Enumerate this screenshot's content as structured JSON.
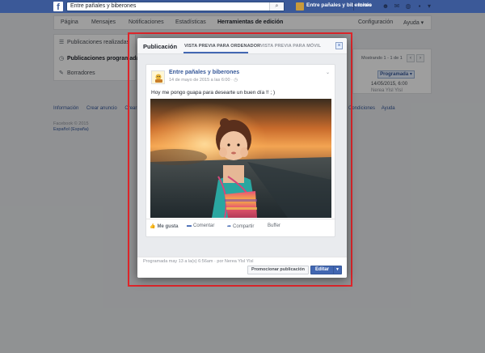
{
  "topbar": {
    "logo": "f",
    "search_value": "Entre pañales y biberones",
    "search_icon": "search-icon",
    "page_name": "Entre pañales y biberones",
    "home": "Inicio",
    "icons": [
      "friends-icon",
      "messages-icon",
      "globe-icon"
    ]
  },
  "tabs": [
    {
      "label": "Página",
      "active": false
    },
    {
      "label": "Mensajes",
      "active": false
    },
    {
      "label": "Notificaciones",
      "active": false
    },
    {
      "label": "Estadísticas",
      "active": false
    },
    {
      "label": "Herramientas de edición",
      "active": true
    },
    {
      "label": "Configuración",
      "active": false
    },
    {
      "label": "Ayuda ▾",
      "active": false
    }
  ],
  "left_nav": [
    {
      "label": "Publicaciones realizadas",
      "icon": "list-icon",
      "active": false
    },
    {
      "label": "Publicaciones programadas",
      "icon": "clock-icon",
      "active": true
    },
    {
      "label": "Borradores",
      "icon": "pencil-icon",
      "active": false
    }
  ],
  "right_panel": {
    "showing": "Mostrando 1 - 1 de 1",
    "filter": "Programada ▾",
    "date": "14/05/2015, 6:00",
    "by": "Nerea Ylsl Ylsl"
  },
  "footer": {
    "links": [
      "Información",
      "Crear anuncio",
      "Crear"
    ],
    "right_links": [
      "Condiciones",
      "Ayuda"
    ],
    "copyright": "Facebook © 2015",
    "language": "Español (España)"
  },
  "modal": {
    "title": "Publicación",
    "tabs": [
      {
        "label": "VISTA PREVIA PARA ORDENADOR",
        "active": true
      },
      {
        "label": "VISTA PREVIA PARA MÓVIL",
        "active": false
      }
    ],
    "close": "×",
    "post": {
      "page_name": "Entre pañales y biberones",
      "meta": "14 de mayo de 2015 a las 6:00 · ",
      "audience_icon": "clock-icon",
      "text": "Hoy me pongo guapa para desearte un buen día !! ; )",
      "actions": [
        "Me gusta",
        "Comentar",
        "Compartir",
        "Buffer"
      ]
    },
    "footer": {
      "note": "Programada may 13 a la(s) 6:56am · por Nerea Ylsl Ylsl",
      "promote": "Promocionar publicación",
      "edit": "Editar"
    }
  },
  "colors": {
    "brand": "#3b5998",
    "accent": "#4267b2",
    "highlight": "#e0262b"
  }
}
